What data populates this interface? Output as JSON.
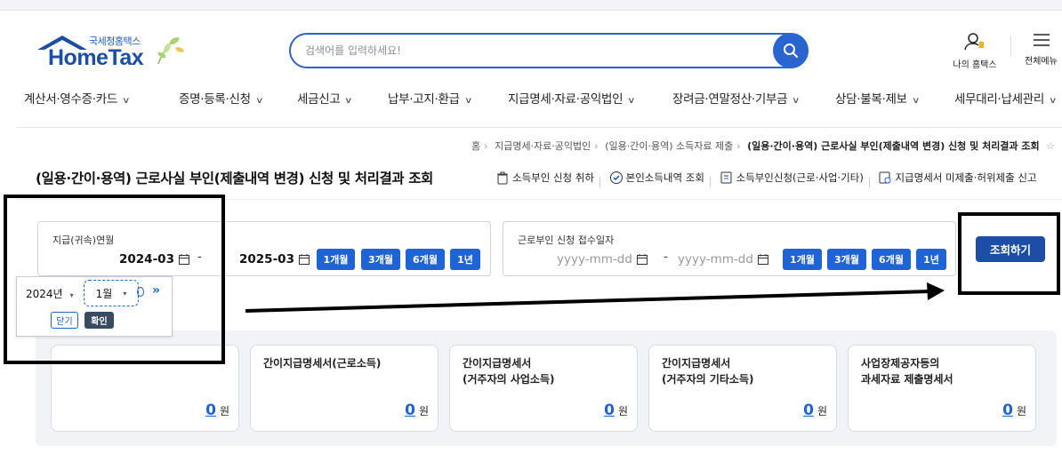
{
  "logo": {
    "subtitle": "국세청홈택스",
    "name": "HomeTax"
  },
  "search": {
    "placeholder": "검색어를 입력하세요!"
  },
  "header": {
    "my_hometax": "나의 홈택스",
    "all_menu": "전체메뉴"
  },
  "gnb": [
    "계산서·영수증·카드",
    "증명·등록·신청",
    "세금신고",
    "납부·고지·환급",
    "지급명세·자료·공익법인",
    "장려금·연말정산·기부금",
    "상담·불복·제보",
    "세무대리·납세관리"
  ],
  "breadcrumb": [
    "홈",
    "지급명세·자료·공익법인",
    "(일용·간이·용역) 소득자료 제출",
    "(일용·간이·용역) 근로사실 부인(제출내역 변경) 신청 및 처리결과 조회"
  ],
  "page_title": "(일용·간이·용역) 근로사실 부인(제출내역 변경) 신청 및 처리결과 조회",
  "quick_links": [
    "소득부인 신청 취하",
    "본인소득내역 조회",
    "소득부인신청(근로·사업·기타)",
    "지급명세서 미제출·허위제출 신고"
  ],
  "filter1": {
    "title": "지급(귀속)연월",
    "start": "2024-03",
    "end": "2025-03",
    "dash": "-",
    "periods": [
      "1개월",
      "3개월",
      "6개월",
      "1년"
    ]
  },
  "filter2": {
    "title": "근로부인 신청 접수일자",
    "start_placeholder": "yyyy-mm-dd",
    "end_placeholder": "yyyy-mm-dd",
    "dash": "-",
    "periods": [
      "1개월",
      "3개월",
      "6개월",
      "1년"
    ]
  },
  "search_button": "조회하기",
  "picker": {
    "year": "2024년",
    "month": "1월",
    "next": "»",
    "close": "닫기",
    "confirm": "확인"
  },
  "cards": [
    {
      "title": "",
      "amount": "0",
      "unit": "원"
    },
    {
      "title": "간이지급명세서(근로소득)",
      "amount": "0",
      "unit": "원"
    },
    {
      "title": "간이지급명세서\n(거주자의 사업소득)",
      "amount": "0",
      "unit": "원"
    },
    {
      "title": "간이지급명세서\n(거주자의 기타소득)",
      "amount": "0",
      "unit": "원"
    },
    {
      "title": "사업장제공자등의\n과세자료 제출명세서",
      "amount": "0",
      "unit": "원"
    }
  ],
  "colors": {
    "primary": "#1f64d6",
    "navy": "#1d4ea5",
    "annotation": "#000000"
  }
}
